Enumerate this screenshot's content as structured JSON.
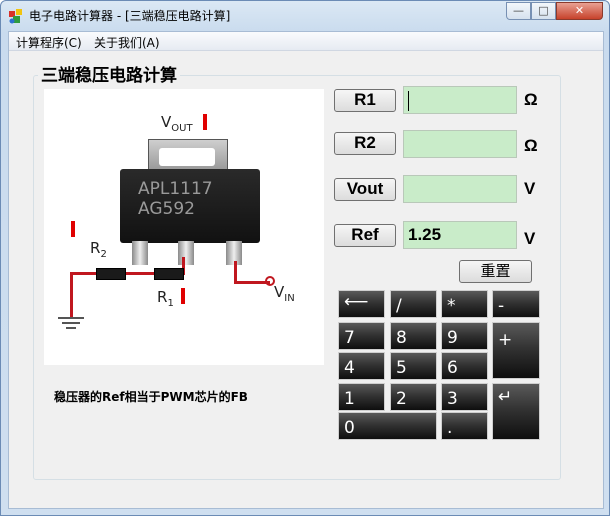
{
  "window": {
    "title": "电子电路计算器 - [三端稳压电路计算]",
    "min_glyph": "—",
    "max_glyph": "□",
    "close_glyph": "✕"
  },
  "menu": [
    {
      "label": "计算程序(C)"
    },
    {
      "label": "关于我们(A)"
    }
  ],
  "group_title": "三端稳压电路计算",
  "figure": {
    "chip_line1": "APL1117",
    "chip_line2": "AG592",
    "vout_main": "V",
    "vout_sub": "OUT",
    "vin_main": "V",
    "vin_sub": "IN",
    "r2_main": "R",
    "r2_sub": "2",
    "r1_main": "R",
    "r1_sub": "1"
  },
  "note": "稳压器的Ref相当于PWM芯片的FB",
  "fields": [
    {
      "button": "R1",
      "value": "",
      "unit": "Ω"
    },
    {
      "button": "R2",
      "value": "",
      "unit": "Ω"
    },
    {
      "button": "Vout",
      "value": "",
      "unit": "V"
    },
    {
      "button": "Ref",
      "value": "1.25",
      "unit": "V"
    }
  ],
  "reset_label": "重置",
  "keypad": {
    "backspace": "⟵",
    "divide": "/",
    "multiply": "*",
    "minus": "-",
    "plus": "+",
    "enter": "↵",
    "k7": "7",
    "k8": "8",
    "k9": "9",
    "k4": "4",
    "k5": "5",
    "k6": "6",
    "k1": "1",
    "k2": "2",
    "k3": "3",
    "k0": "0",
    "dot": "."
  },
  "colors": {
    "field_bg": "#c9ecc9",
    "marker_red": "#e00000",
    "key_bg": "#1a1a1a"
  }
}
